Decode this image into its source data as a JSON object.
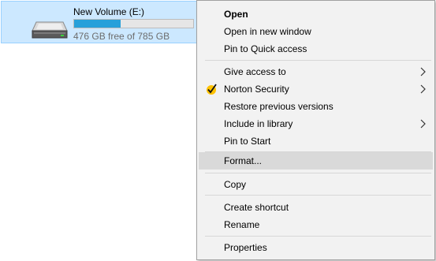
{
  "drive": {
    "name": "New Volume (E:)",
    "free_text": "476 GB free of 785 GB",
    "used_fraction": 0.394,
    "icon": "hard-drive-icon",
    "bar_color": "#26a0da"
  },
  "context_menu": {
    "items": [
      {
        "label": "Open"
      },
      {
        "label": "Open in new window"
      },
      {
        "label": "Pin to Quick access"
      },
      {
        "label": "Give access to"
      },
      {
        "label": "Norton Security"
      },
      {
        "label": "Restore previous versions"
      },
      {
        "label": "Include in library"
      },
      {
        "label": "Pin to Start"
      },
      {
        "label": "Format..."
      },
      {
        "label": "Copy"
      },
      {
        "label": "Create shortcut"
      },
      {
        "label": "Rename"
      },
      {
        "label": "Properties"
      }
    ],
    "hovered_item": "Format...",
    "hover_color": "#d9d9d9",
    "norton_icon": "norton-check-icon",
    "submenu_icon": "chevron-right-icon"
  }
}
